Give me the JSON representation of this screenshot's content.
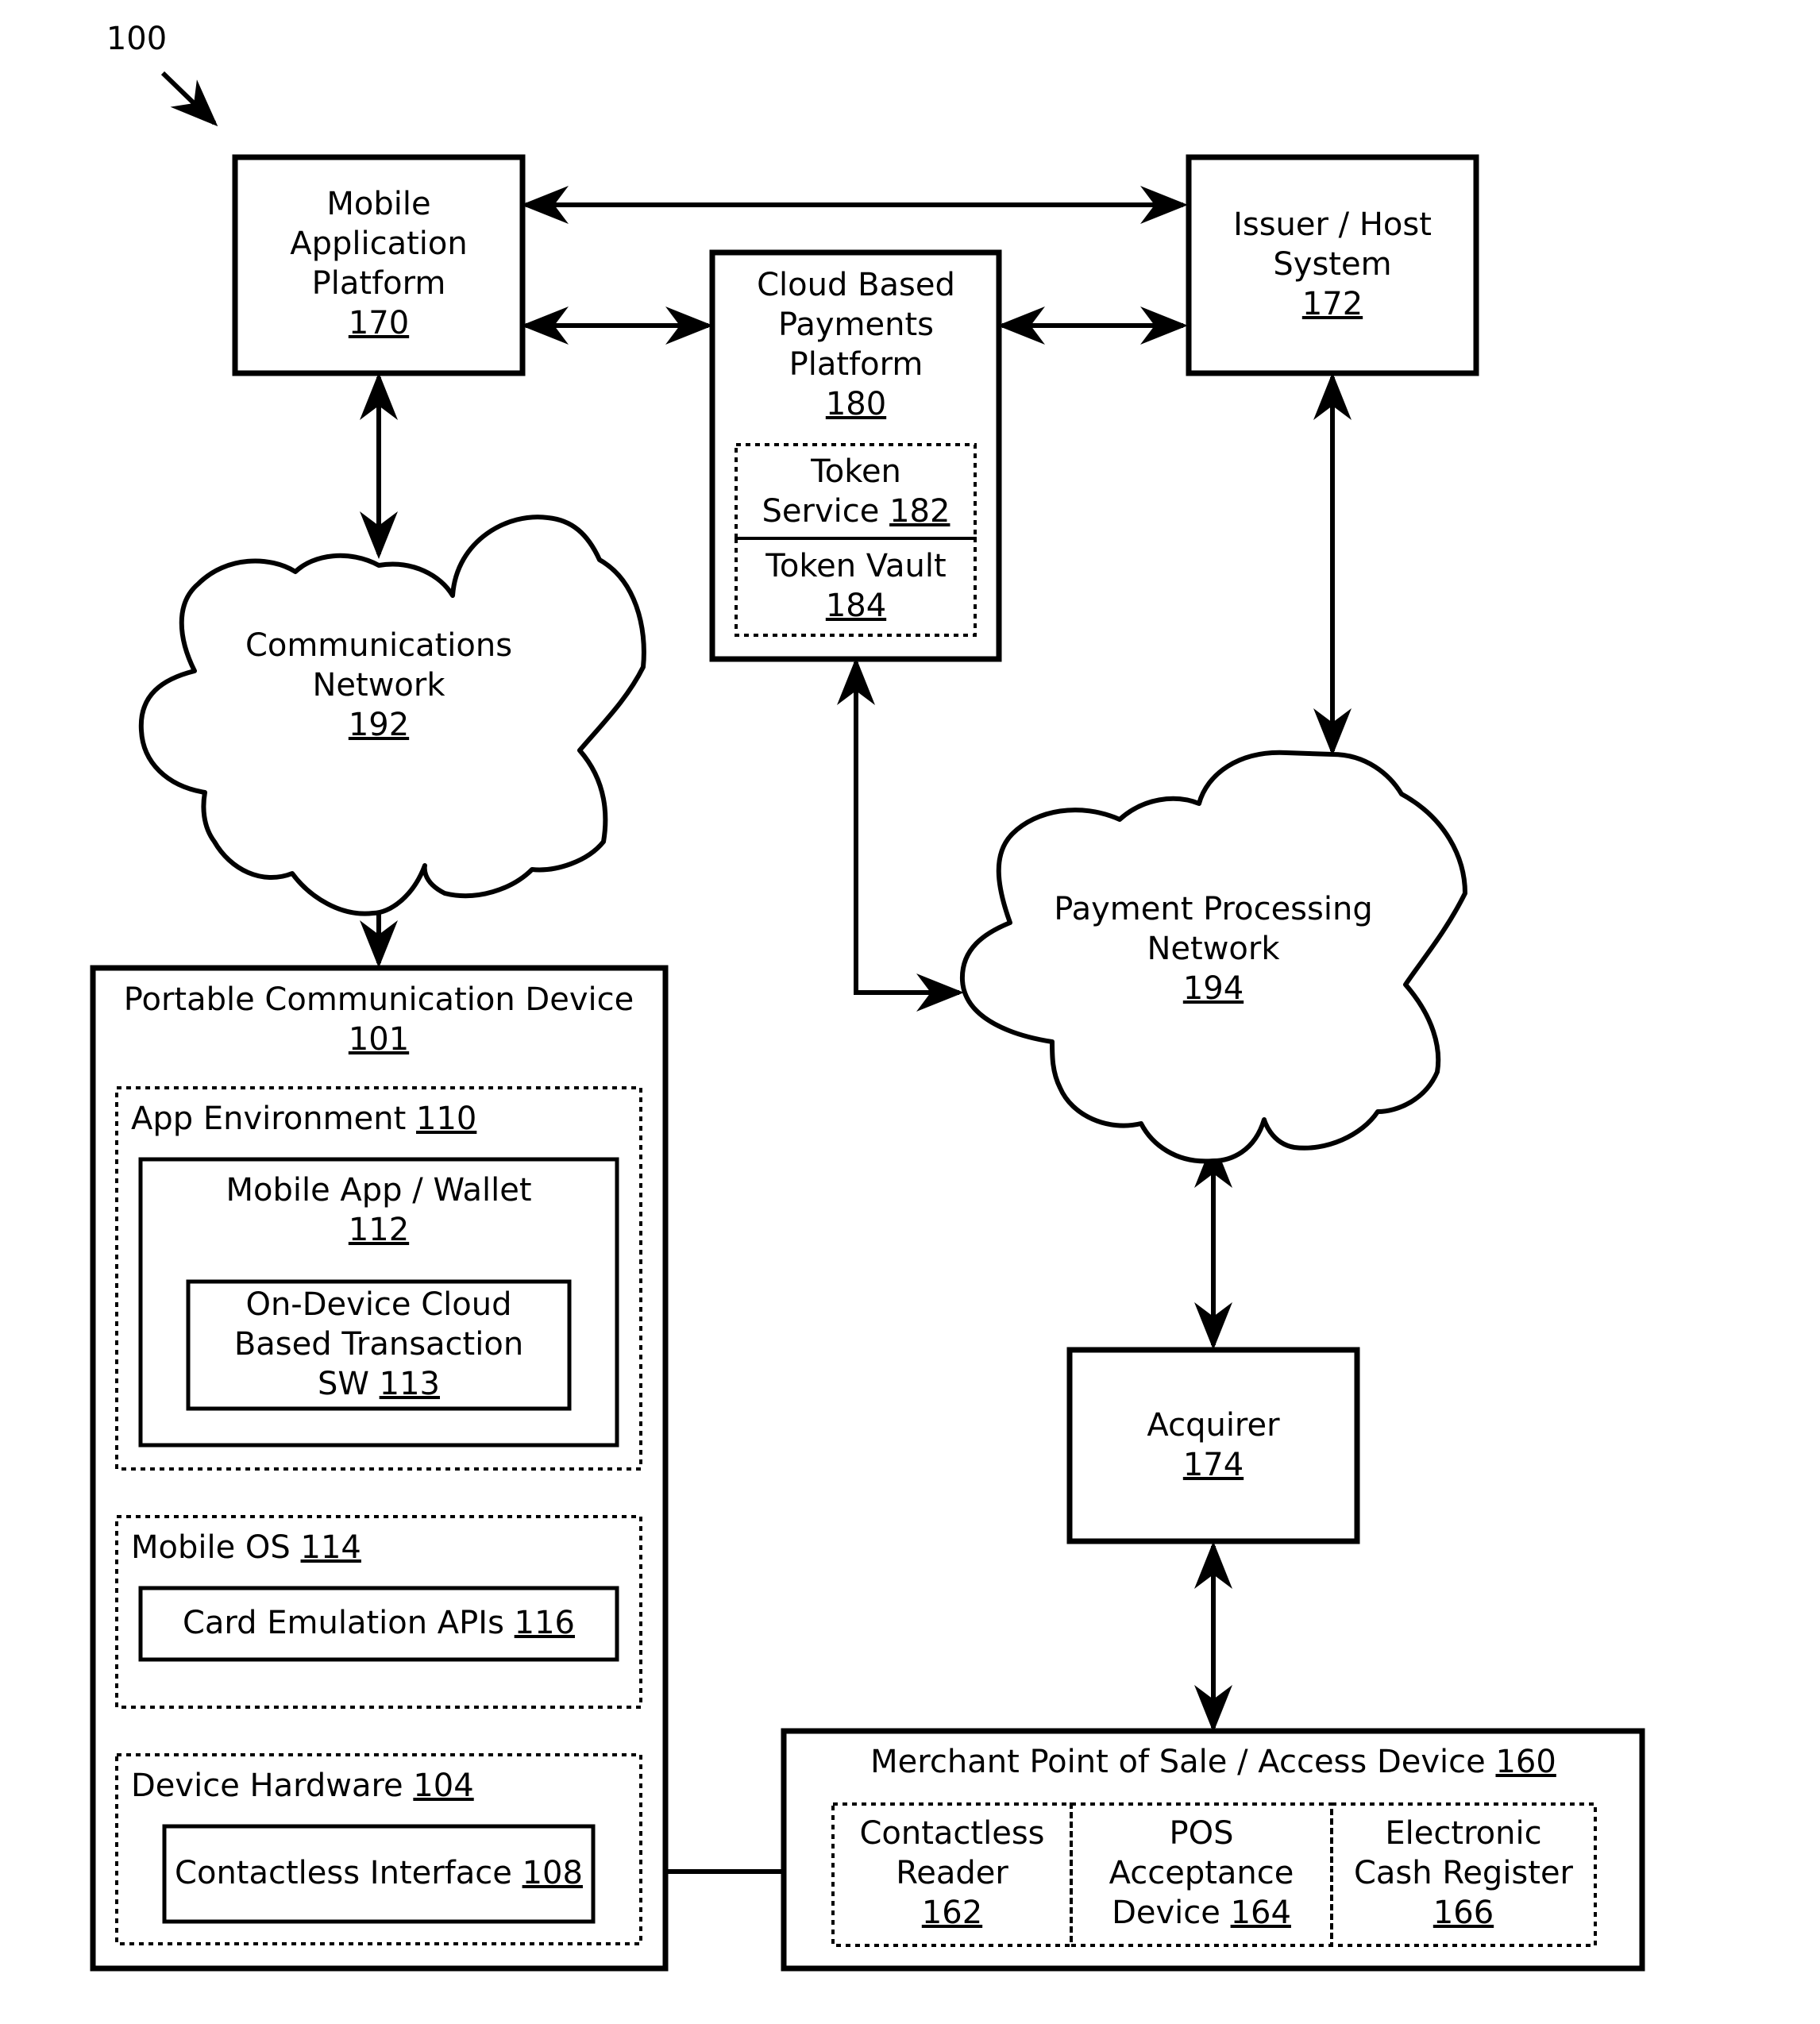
{
  "figure": {
    "ref_label": "100",
    "colors": {
      "line": "#000000",
      "background": "#ffffff"
    }
  },
  "nodes": {
    "mobile_app_platform": {
      "lines": [
        "Mobile",
        "Application",
        "Platform"
      ],
      "ref": "170"
    },
    "issuer_host": {
      "lines": [
        "Issuer / Host",
        "System"
      ],
      "ref": "172"
    },
    "cloud_payments": {
      "lines": [
        "Cloud Based",
        "Payments",
        "Platform"
      ],
      "ref": "180"
    },
    "token_service": {
      "line1": "Token",
      "line2": "Service",
      "ref": "182"
    },
    "token_vault": {
      "line1": "Token Vault",
      "ref": "184"
    },
    "comm_network": {
      "lines": [
        "Communications",
        "Network"
      ],
      "ref": "192"
    },
    "payment_network": {
      "lines": [
        "Payment Processing",
        "Network"
      ],
      "ref": "194"
    },
    "acquirer": {
      "lines": [
        "Acquirer"
      ],
      "ref": "174"
    },
    "portable_device": {
      "line1": "Portable Communication Device",
      "ref": "101"
    },
    "app_environment": {
      "label": "App Environment",
      "ref": "110"
    },
    "mobile_wallet": {
      "line1": "Mobile App / Wallet",
      "ref": "112"
    },
    "on_device_sw": {
      "line1": "On-Device Cloud",
      "line2": "Based Transaction",
      "line3": "SW",
      "ref": "113"
    },
    "mobile_os": {
      "label": "Mobile OS",
      "ref": "114"
    },
    "card_emulation": {
      "label": "Card Emulation APIs",
      "ref": "116"
    },
    "device_hardware": {
      "label": "Device Hardware",
      "ref": "104"
    },
    "contactless_interface": {
      "label": "Contactless Interface",
      "ref": "108"
    },
    "merchant_pos": {
      "label": "Merchant Point of Sale / Access Device",
      "ref": "160"
    },
    "contactless_reader": {
      "line1": "Contactless",
      "line2": "Reader",
      "ref": "162"
    },
    "pos_acceptance": {
      "line1": "POS",
      "line2": "Acceptance",
      "line3": "Device",
      "ref": "164"
    },
    "cash_register": {
      "line1": "Electronic",
      "line2": "Cash Register",
      "ref": "166"
    }
  }
}
